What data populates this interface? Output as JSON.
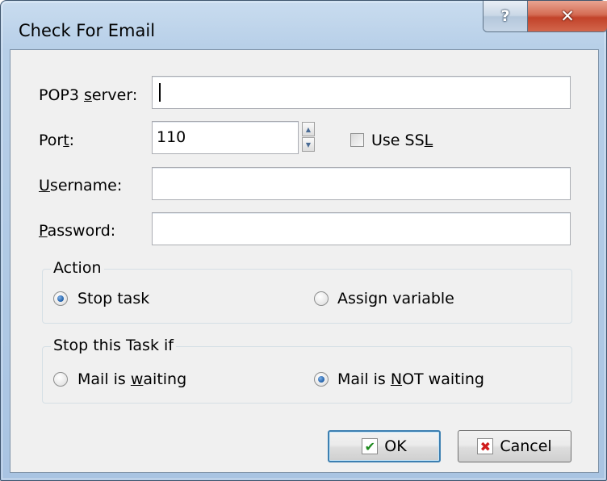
{
  "window": {
    "title": "Check For Email",
    "help_glyph": "?",
    "close_glyph": "✕"
  },
  "fields": {
    "pop3_label_pre": "POP3 ",
    "pop3_label_mn": "s",
    "pop3_label_post": "erver:",
    "pop3_value": "",
    "port_label_pre": "Por",
    "port_label_mn": "t",
    "port_label_post": ":",
    "port_value": "110",
    "use_ssl_pre": "Use SS",
    "use_ssl_mn": "L",
    "use_ssl_checked": false,
    "username_label_mn": "U",
    "username_label_post": "sername:",
    "username_value": "",
    "password_label_mn": "P",
    "password_label_post": "assword:",
    "password_value": ""
  },
  "action_group": {
    "title": "Action",
    "options": [
      {
        "label": "Stop task",
        "selected": true
      },
      {
        "label": "Assign variable",
        "selected": false
      }
    ]
  },
  "stop_group": {
    "title": "Stop this Task if",
    "opt1_pre": "Mail is ",
    "opt1_mn": "w",
    "opt1_post": "aiting",
    "opt1_selected": false,
    "opt2_pre": "Mail is ",
    "opt2_mn": "N",
    "opt2_post": "OT waiting",
    "opt2_selected": true
  },
  "buttons": {
    "ok_label": "OK",
    "cancel_label": "Cancel",
    "ok_icon": "check-icon",
    "cancel_icon": "x-icon"
  },
  "colors": {
    "frame": "#b7cfe8",
    "close_button": "#c2432a",
    "default_button_border": "#3c7fb1"
  }
}
